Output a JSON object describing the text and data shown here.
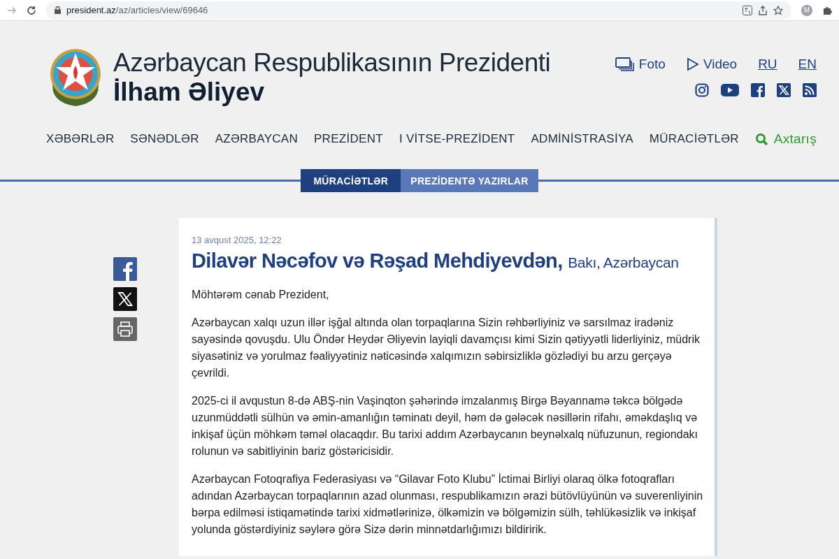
{
  "browser": {
    "url_host": "president.az",
    "url_path": "/az/articles/view/69646",
    "profile_initial": "M"
  },
  "header": {
    "title": "Azərbaycan Respublikasının Prezidenti",
    "name": "İlham Əliyev",
    "media_links": [
      {
        "kind": "photo",
        "label": "Foto"
      },
      {
        "kind": "video",
        "label": "Video"
      }
    ],
    "languages": [
      "RU",
      "EN"
    ],
    "social": [
      {
        "kind": "instagram"
      },
      {
        "kind": "youtube"
      },
      {
        "kind": "facebook"
      },
      {
        "kind": "x"
      },
      {
        "kind": "rss"
      }
    ]
  },
  "nav": {
    "items": [
      "XƏBƏRLƏR",
      "SƏNƏDLƏR",
      "AZƏRBAYCAN",
      "PREZİDENT",
      "I VİTSE-PREZİDENT",
      "ADMİNİSTRASİYA",
      "MÜRACİƏTLƏR"
    ],
    "search": "Axtarış"
  },
  "subtabs": [
    {
      "label": "MÜRACİƏTLƏR",
      "selected": true
    },
    {
      "label": "PREZİDENTƏ YAZIRLAR",
      "selected": false
    }
  ],
  "share": [
    {
      "kind": "facebook"
    },
    {
      "kind": "x"
    },
    {
      "kind": "print"
    }
  ],
  "article": {
    "date": "13 avqust 2025, 12:22",
    "author": "Dilavər Nəcəfov və Rəşad Mehdiyevdən,",
    "place": "Bakı, Azərbaycan",
    "paragraphs": [
      "Möhtərəm cənab Prezident,",
      "Azərbaycan xalqı uzun illər işğal altında olan torpaqlarına Sizin rəhbərliyiniz və sarsılmaz iradəniz sayəsində qovuşdu. Ulu Öndər Heydər Əliyevin layiqli davamçısı kimi Sizin qətiyyətli liderliyiniz, müdrik siyasətiniz və yorulmaz fəaliyyətiniz nəticəsində xalqımızın səbirsizliklə gözlədiyi bu arzu gerçəyə çevrildi.",
      "2025-ci il avqustun 8-də ABŞ-nin Vaşinqton şəhərində imzalanmış Birgə Bəyannamə təkcə bölgədə uzunmüddətli sülhün və əmin-amanlığın təminatı deyil, həm də gələcək nəsillərin rifahı, əməkdaşlıq və inkişaf üçün möhkəm təməl olacaqdır. Bu tarixi addım Azərbaycanın beynəlxalq nüfuzunun, regiondakı rolunun və sabitliyinin bariz göstəricisidir.",
      "Azərbaycan Fotoqrafiya Federasiyası və “Gilavar Foto Klubu” İctimai Birliyi olaraq ölkə fotoqrafları adından Azərbaycan torpaqlarının azad olunması, respublikamızın ərazi bütövlüyünün və suverenliyinin bərpa edilməsi istiqamətində tarixi xidmətlərinizə, ölkəmizin və bölgəmizin sülh, təhlükəsizlik və inkişaf yolunda göstərdiyiniz səylərə görə Sizə dərin minnətdarlığımızı bildiririk."
    ]
  }
}
